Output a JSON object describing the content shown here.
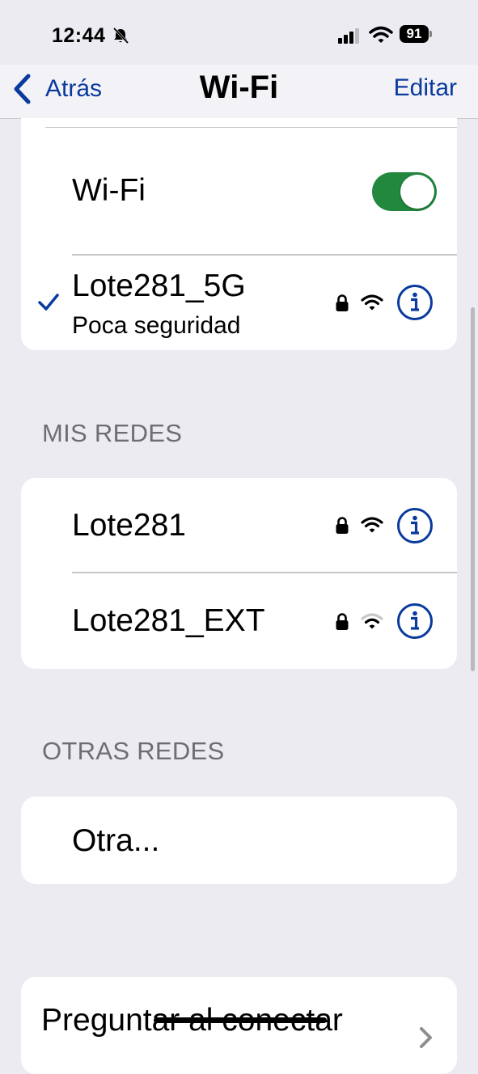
{
  "status": {
    "time": "12:44",
    "battery": "91"
  },
  "nav": {
    "back_label": "Atrás",
    "title": "Wi-Fi",
    "edit_label": "Editar"
  },
  "wifi_toggle": {
    "label": "Wi-Fi",
    "on": true
  },
  "connected": {
    "name": "Lote281_5G",
    "subtitle": "Poca seguridad"
  },
  "my_networks": {
    "header": "MIS REDES",
    "items": [
      {
        "name": "Lote281"
      },
      {
        "name": "Lote281_EXT"
      }
    ]
  },
  "other_networks": {
    "header": "OTRAS REDES",
    "other_label": "Otra..."
  },
  "ask_to_join": {
    "label": "Preguntar al conectar"
  },
  "colors": {
    "accent": "#0A3A9E",
    "toggle_on": "#22883E",
    "background": "#ECEBF1"
  }
}
